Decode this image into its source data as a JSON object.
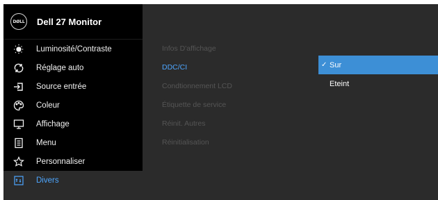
{
  "header": {
    "logo_text": "DØLL",
    "model": "Dell 27 Monitor"
  },
  "menu": {
    "items": [
      {
        "label": "Luminosité/Contraste",
        "icon": "brightness-icon"
      },
      {
        "label": "Réglage auto",
        "icon": "auto-adjust-icon"
      },
      {
        "label": "Source entrée",
        "icon": "input-source-icon"
      },
      {
        "label": "Coleur",
        "icon": "color-palette-icon"
      },
      {
        "label": "Affichage",
        "icon": "display-icon"
      },
      {
        "label": "Menu",
        "icon": "menu-icon"
      },
      {
        "label": "Personnaliser",
        "icon": "star-icon"
      },
      {
        "label": "Divers",
        "icon": "others-icon"
      }
    ],
    "active_index": 7
  },
  "submenu": {
    "items": [
      "Infos D'affichage",
      "DDC/CI",
      "Condtionnement LCD",
      "Étiquette de service",
      "Réinit. Autres",
      "Réinitialisation"
    ],
    "active_index": 1
  },
  "options": {
    "items": [
      {
        "check": "✓",
        "label": "Sur",
        "selected": true
      },
      {
        "check": "",
        "label": "Eteint",
        "selected": false
      }
    ]
  },
  "colors": {
    "accent": "#4da6ff",
    "selection": "#3d8fd6",
    "sidebar_bg": "#000000",
    "panel_bg": "#2b2b2b"
  }
}
